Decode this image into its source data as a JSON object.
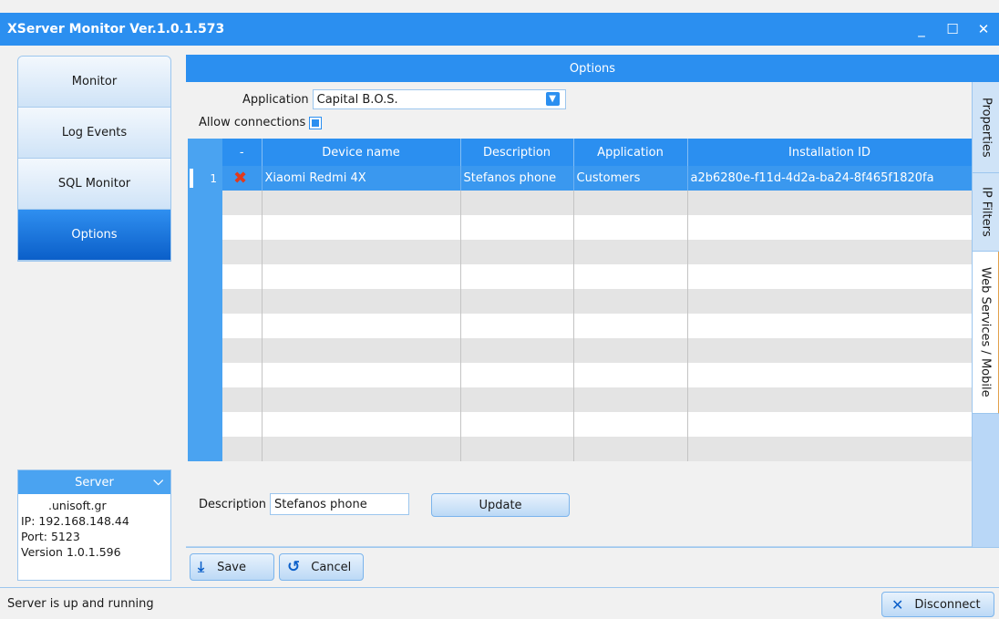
{
  "window": {
    "title": "XServer Monitor Ver.1.0.1.573",
    "minimize_icon": "_",
    "maximize_icon": "☐",
    "close_icon": "✕"
  },
  "nav": {
    "items": [
      {
        "label": "Monitor",
        "active": false
      },
      {
        "label": "Log Events",
        "active": false
      },
      {
        "label": "SQL Monitor",
        "active": false
      },
      {
        "label": "Options",
        "active": true
      }
    ]
  },
  "server": {
    "header": "Server",
    "host": ".unisoft.gr",
    "ip": "IP: 192.168.148.44",
    "port": "Port: 5123",
    "version": "Version 1.0.1.596"
  },
  "options": {
    "header": "Options",
    "application_label": "Application",
    "application_value": "Capital B.O.S.",
    "allow_label": "Allow connections",
    "allow_checked": true,
    "description_label": "Description",
    "description_value": "Stefanos phone",
    "update_label": "Update"
  },
  "grid": {
    "columns": [
      "-",
      "Device name",
      "Description",
      "Application",
      "Installation ID"
    ],
    "rows": [
      {
        "num": "1",
        "device": "Xiaomi Redmi 4X",
        "description": "Stefanos phone",
        "application": "Customers",
        "installation_id": "a2b6280e-f11d-4d2a-ba24-8f465f1820fa"
      }
    ]
  },
  "side_tabs": [
    {
      "label": "Properties",
      "active": false
    },
    {
      "label": "IP Filters",
      "active": false
    },
    {
      "label": "Web Services / Mobile",
      "active": true
    }
  ],
  "actions": {
    "save_label": "Save",
    "cancel_label": "Cancel"
  },
  "statusbar": {
    "status": "Server is up and running",
    "disconnect_label": "Disconnect"
  },
  "colors": {
    "accent": "#2b8ff0",
    "selected_row": "#3a98ef",
    "delete_icon": "#e03a1e"
  }
}
